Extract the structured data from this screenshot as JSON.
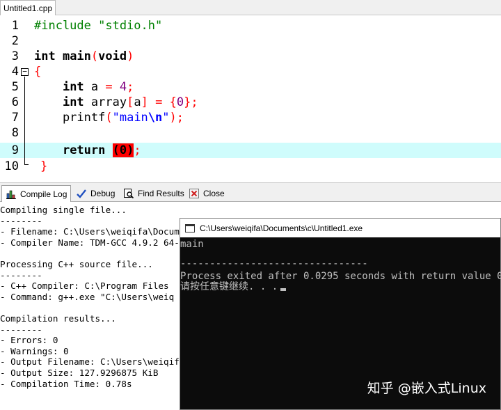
{
  "editor_tab": {
    "filename": "Untitled1.cpp"
  },
  "code_lines": [
    {
      "num": "1"
    },
    {
      "num": "2"
    },
    {
      "num": "3"
    },
    {
      "num": "4"
    },
    {
      "num": "5"
    },
    {
      "num": "6"
    },
    {
      "num": "7"
    },
    {
      "num": "8"
    },
    {
      "num": "9"
    },
    {
      "num": "10"
    }
  ],
  "code": {
    "l1_include": "#include \"stdio.h\"",
    "l3_int": "int",
    "l3_main": " main",
    "l3_open": "(",
    "l3_void": "void",
    "l3_close": ")",
    "l4_brace": "{",
    "l5_indent": "    ",
    "l5_int": "int",
    "l5_a": " a ",
    "l5_eq": "=",
    "l5_sp": " ",
    "l5_num": "4",
    "l5_semi": ";",
    "l6_indent": "    ",
    "l6_int": "int",
    "l6_array": " array",
    "l6_lb": "[",
    "l6_a": "a",
    "l6_rb": "]",
    "l6_sp1": " ",
    "l6_eq": "=",
    "l6_sp2": " ",
    "l6_lc": "{",
    "l6_zero": "0",
    "l6_rc": "}",
    "l6_semi": ";",
    "l7_indent": "    printf",
    "l7_open": "(",
    "l7_str": "\"main",
    "l7_esc": "\\n",
    "l7_strend": "\"",
    "l7_close": ")",
    "l7_semi": ";",
    "l9_indent": "    ",
    "l9_return": "return",
    "l9_sp": " ",
    "l9_open": "(",
    "l9_zero": "0",
    "l9_close": ")",
    "l9_semi": ";",
    "l10_brace": "}"
  },
  "tool_tabs": {
    "compile_log": "Compile Log",
    "debug": "Debug",
    "find_results": "Find Results",
    "close": "Close"
  },
  "compile_log": [
    "Compiling single file...",
    "--------",
    "- Filename: C:\\Users\\weiqifa\\Docum",
    "- Compiler Name: TDM-GCC 4.9.2 64-",
    "",
    "Processing C++ source file...",
    "--------",
    "- C++ Compiler: C:\\Program Files",
    "- Command: g++.exe \"C:\\Users\\weiq",
    "",
    "Compilation results...",
    "--------",
    "- Errors: 0",
    "- Warnings: 0",
    "- Output Filename: C:\\Users\\weiqif",
    "- Output Size: 127.9296875 KiB",
    "- Compilation Time: 0.78s"
  ],
  "console": {
    "title": "C:\\Users\\weiqifa\\Documents\\c\\Untitled1.exe",
    "lines": [
      "main",
      "",
      "--------------------------------",
      "Process exited after 0.0295 seconds with return value 0",
      "请按任意键继续. . ."
    ],
    "watermark": "知乎 @嵌入式Linux"
  },
  "colors": {
    "current_line": "#cffcfc",
    "preprocessor": "#008000",
    "string": "#0000ff",
    "number": "#800080",
    "symbol": "#ff0000",
    "console_bg": "#0c0c0c",
    "console_fg": "#c0c0c0"
  }
}
